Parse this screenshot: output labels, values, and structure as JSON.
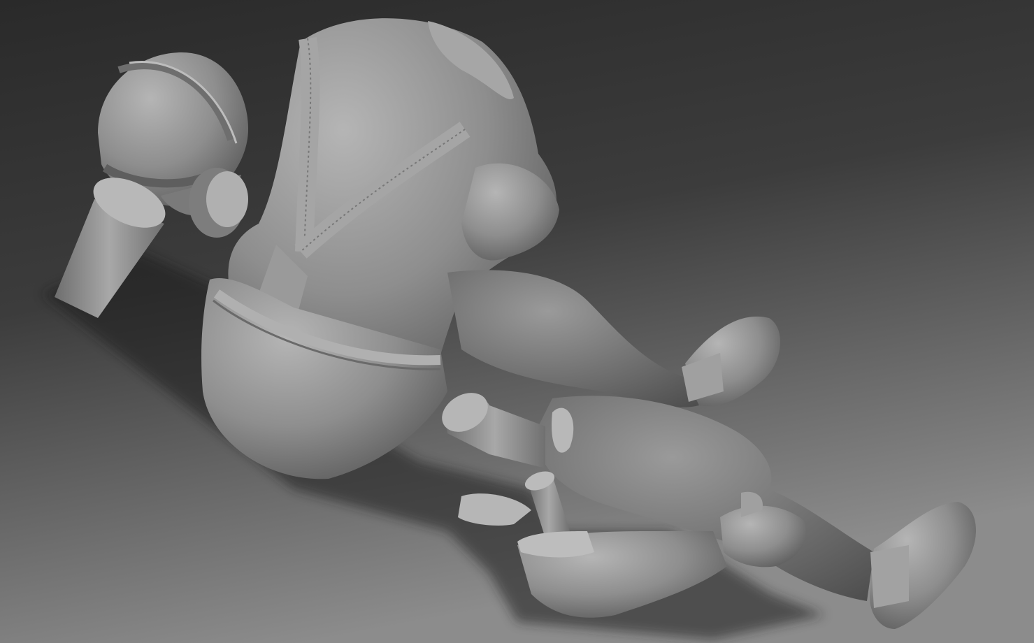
{
  "viewport": {
    "background_top": "#2e2e2e",
    "background_bottom": "#8a8a8a",
    "material_color": "#8f8f8f",
    "shadow_color": "#1a1a1a"
  },
  "scene": {
    "subject": "sculpt-model-seated-figure",
    "icon": "3d-model-icon"
  }
}
